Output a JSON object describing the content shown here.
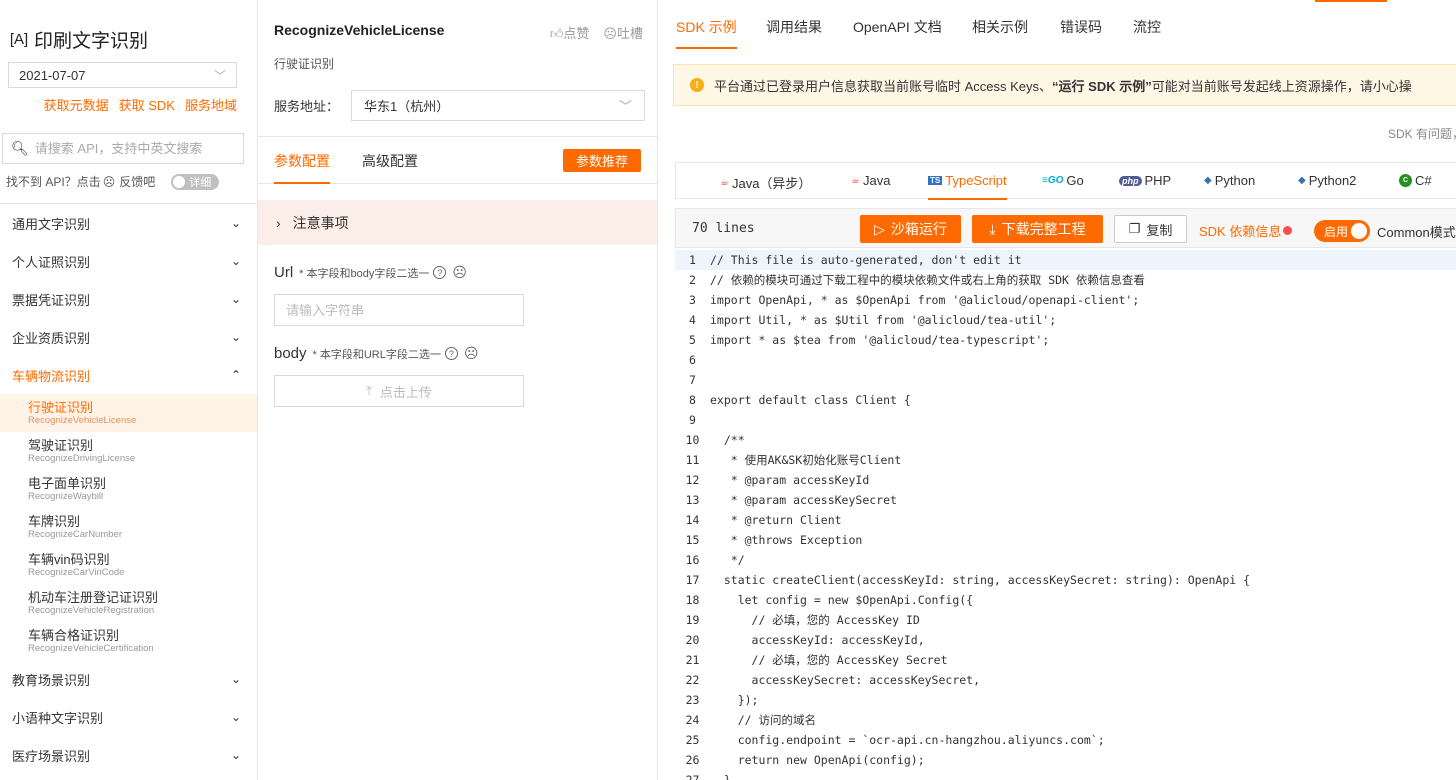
{
  "brand": {
    "logo": "[A]",
    "title": "印刷文字识别"
  },
  "date": "2021-07-07",
  "links": [
    "获取元数据",
    "获取 SDK",
    "服务地域"
  ],
  "search": {
    "placeholder": "请搜索 API，支持中英文搜索"
  },
  "hint": {
    "text": "找不到 API？点击",
    "feedback": "反馈吧",
    "toggle": "详细"
  },
  "nav": {
    "categories_top": [
      "通用文字识别",
      "个人证照识别",
      "票据凭证识别",
      "企业资质识别"
    ],
    "open_category": "车辆物流识别",
    "items": [
      {
        "cn": "行驶证识别",
        "en": "RecognizeVehicleLicense"
      },
      {
        "cn": "驾驶证识别",
        "en": "RecognizeDrivingLicense"
      },
      {
        "cn": "电子面单识别",
        "en": "RecognizeWaybill"
      },
      {
        "cn": "车牌识别",
        "en": "RecognizeCarNumber"
      },
      {
        "cn": "车辆vin码识别",
        "en": "RecognizeCarVinCode"
      },
      {
        "cn": "机动车注册登记证识别",
        "en": "RecognizeVehicleRegistration"
      },
      {
        "cn": "车辆合格证识别",
        "en": "RecognizeVehicleCertification"
      }
    ],
    "categories_bottom": [
      "教育场景识别",
      "小语种文字识别",
      "医疗场景识别"
    ]
  },
  "api": {
    "name": "RecognizeVehicleLicense",
    "sub": "行驶证识别",
    "like": "点赞",
    "complain": "吐槽"
  },
  "service": {
    "label": "服务地址：",
    "value": "华东1（杭州）"
  },
  "mid_tabs": {
    "params": "参数配置",
    "advanced": "高级配置",
    "recommend": "参数推荐"
  },
  "notice": "注意事项",
  "params": {
    "url": {
      "name": "Url",
      "note": "* 本字段和body字段二选一",
      "placeholder": "请输入字符串"
    },
    "body": {
      "name": "body",
      "note": "* 本字段和URL字段二选一",
      "upload": "点击上传"
    }
  },
  "right_tabs": [
    "SDK 示例",
    "调用结果",
    "OpenAPI 文档",
    "相关示例",
    "错误码",
    "流控"
  ],
  "warning": {
    "pre": "平台通过已登录用户信息获取当前账号临时 Access Keys、",
    "bold": "“运行 SDK 示例”",
    "post": " 可能对当前账号发起线上资源操作，请小心操"
  },
  "sdk_question": "SDK 有问题，",
  "languages": [
    "Java（异步）",
    "Java",
    "TypeScript",
    "Go",
    "PHP",
    "Python",
    "Python2",
    "C#"
  ],
  "code_header": {
    "lines": "70 lines",
    "run": "沙箱运行",
    "download": "下载完整工程",
    "copy": "复制",
    "deps": "SDK 依赖信息",
    "toggle": "启用",
    "mode": "Common模式"
  },
  "code_lines": [
    "// This file is auto-generated, don't edit it",
    "// 依赖的模块可通过下载工程中的模块依赖文件或右上角的获取 SDK 依赖信息查看",
    "import OpenApi, * as $OpenApi from '@alicloud/openapi-client';",
    "import Util, * as $Util from '@alicloud/tea-util';",
    "import * as $tea from '@alicloud/tea-typescript';",
    "",
    "",
    "export default class Client {",
    "",
    "  /**",
    "   * 使用AK&SK初始化账号Client",
    "   * @param accessKeyId",
    "   * @param accessKeySecret",
    "   * @return Client",
    "   * @throws Exception",
    "   */",
    "  static createClient(accessKeyId: string, accessKeySecret: string): OpenApi {",
    "    let config = new $OpenApi.Config({",
    "      // 必填，您的 AccessKey ID",
    "      accessKeyId: accessKeyId,",
    "      // 必填，您的 AccessKey Secret",
    "      accessKeySecret: accessKeySecret,",
    "    });",
    "    // 访问的域名",
    "    config.endpoint = `ocr-api.cn-hangzhou.aliyuncs.com`;",
    "    return new OpenApi(config);",
    "  }"
  ],
  "colors": {
    "accent": "#ff6a00",
    "warning_bg": "#fff7e6",
    "active_bg": "#fff3e8"
  }
}
